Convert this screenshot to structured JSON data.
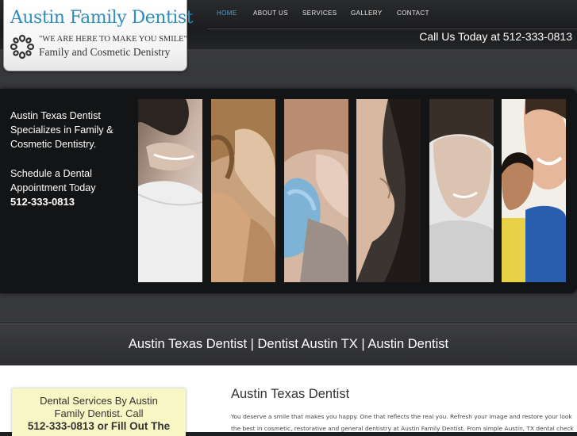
{
  "logo": {
    "title": "Austin Family Dentist",
    "tagline": "\"WE ARE HERE TO MAKE YOU SMILE\"",
    "subtitle": "Family and Cosmetic Denistry"
  },
  "nav": {
    "items": [
      "HOME",
      "ABOUT US",
      "SERVICES",
      "GALLERY",
      "CONTACT"
    ],
    "active": "HOME"
  },
  "header": {
    "call_text": "Call Us Today at 512-333-0813"
  },
  "banner": {
    "line1": "Austin Texas Dentist",
    "line2": "Specializes in Family &",
    "line3": "Cosmetic Dentistry.",
    "line4": "Schedule a Dental",
    "line5": "Appointment Today",
    "phone": "512-333-0813"
  },
  "subband": {
    "text": "Austin Texas Dentist | Dentist Austin TX | Austin Dentist"
  },
  "sidebar": {
    "line1": "Dental Services By Austin",
    "line2": "Family Dentist. Call",
    "line3": "512-333-0813 or Fill Out The"
  },
  "article": {
    "title": "Austin Texas Dentist",
    "line1": "You deserve a smile that makes you happy. One that reflects the real you. Refresh your image and restore your look with",
    "line2": "the best in cosmetic, restorative and general dentistry at Austin Family Dentist. From simple Austin, TX dental check-ups and"
  },
  "colors": {
    "accent": "#2f8db9",
    "nav_active": "#57a0c8",
    "sticky_bg": "#f8f6c4"
  }
}
